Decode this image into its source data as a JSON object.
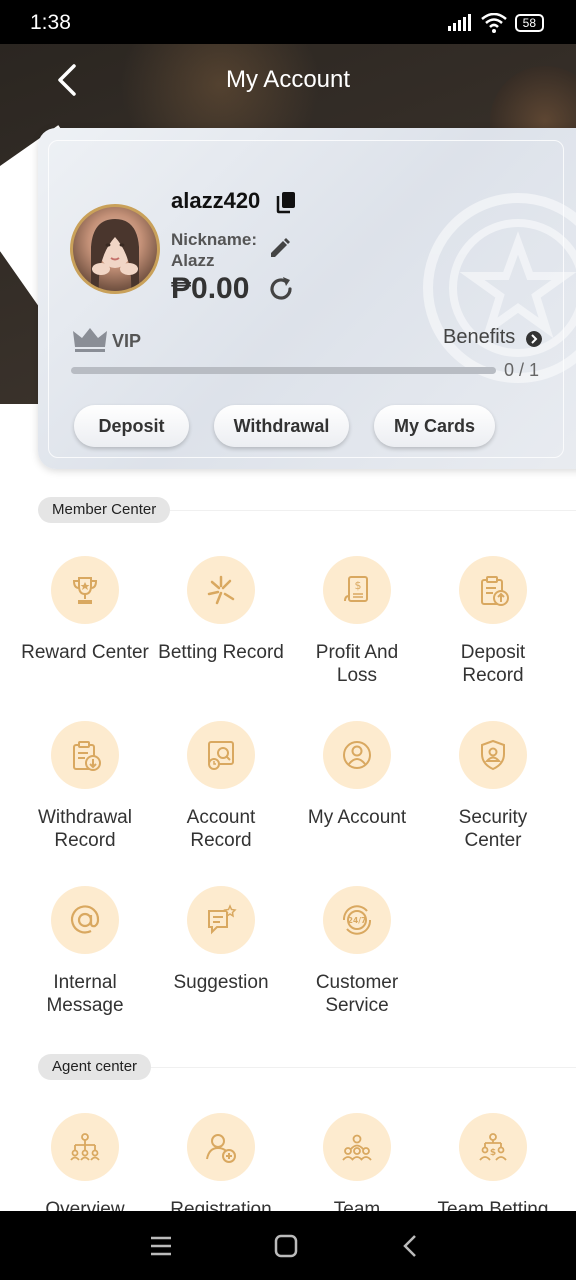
{
  "status": {
    "time": "1:38",
    "battery": "58"
  },
  "header": {
    "title": "My Account"
  },
  "profile": {
    "username": "alazz420",
    "nickname_label": "Nickname:",
    "nickname": "Alazz",
    "balance": "₱0.00"
  },
  "vip": {
    "label": "VIP",
    "benefits": "Benefits",
    "progress": "0 / 1",
    "progress_value": 0
  },
  "actions": {
    "deposit": "Deposit",
    "withdrawal": "Withdrawal",
    "my_cards": "My Cards"
  },
  "member_center": {
    "title": "Member Center",
    "items": [
      {
        "label": "Reward Center",
        "icon": "trophy-icon"
      },
      {
        "label": "Betting Record",
        "icon": "betting-icon"
      },
      {
        "label": "Profit And Loss",
        "icon": "profit-icon"
      },
      {
        "label": "Deposit Record",
        "icon": "deposit-record-icon"
      },
      {
        "label": "Withdrawal Record",
        "icon": "withdrawal-record-icon"
      },
      {
        "label": "Account Record",
        "icon": "account-record-icon"
      },
      {
        "label": "My Account",
        "icon": "user-icon"
      },
      {
        "label": "Security Center",
        "icon": "shield-icon"
      },
      {
        "label": "Internal Message",
        "icon": "at-icon"
      },
      {
        "label": "Suggestion",
        "icon": "suggestion-icon"
      },
      {
        "label": "Customer Service",
        "icon": "support-247-icon"
      }
    ]
  },
  "agent_center": {
    "title": "Agent center",
    "items": [
      {
        "label": "Overview",
        "icon": "hierarchy-icon"
      },
      {
        "label": "Registration",
        "icon": "add-user-icon"
      },
      {
        "label": "Team",
        "icon": "team-icon"
      },
      {
        "label": "Team Betting",
        "icon": "team-betting-icon"
      }
    ]
  },
  "colors": {
    "accent_circle": "#fdebcf",
    "icon_gold": "#d9a860",
    "header_dark": "#2b2621"
  }
}
